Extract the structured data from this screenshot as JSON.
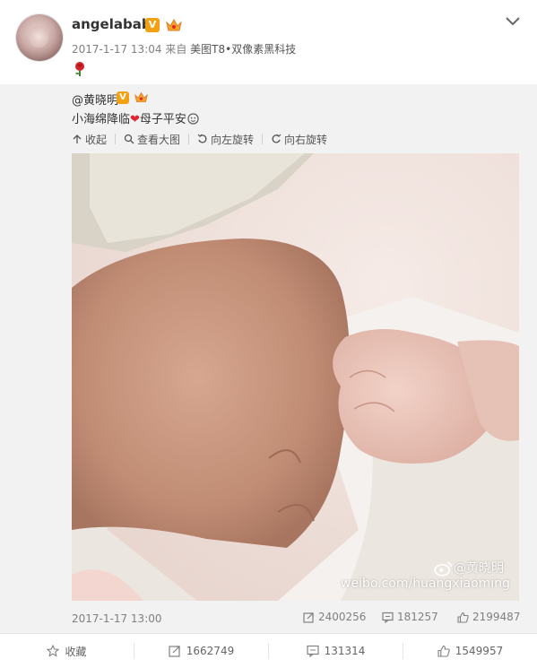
{
  "post": {
    "username": "angelababy",
    "v_badge": "V",
    "timestamp": "2017-1-17 13:04",
    "source_prefix": "来自",
    "source": "美图T8•双像素黑科技"
  },
  "quoted": {
    "mention": "@黄晓明",
    "v_badge": "V",
    "text_before": "小海绵降临",
    "text_after": "母子平安",
    "toolbar": {
      "collapse": "收起",
      "view_large": "查看大图",
      "rotate_left": "向左旋转",
      "rotate_right": "向右旋转"
    },
    "watermark_name": "@黄晓明",
    "watermark_url": "weibo.com/huangxiaoming",
    "date": "2017-1-17 13:00",
    "stats": {
      "reposts": "2400256",
      "comments": "181257",
      "likes": "2199487"
    }
  },
  "actions": {
    "favorite": "收藏",
    "repost": "1662749",
    "comment": "131314",
    "like": "1549957"
  },
  "colors": {
    "badge": "#f3a012",
    "heart": "#e0262e",
    "meta": "#808080"
  }
}
